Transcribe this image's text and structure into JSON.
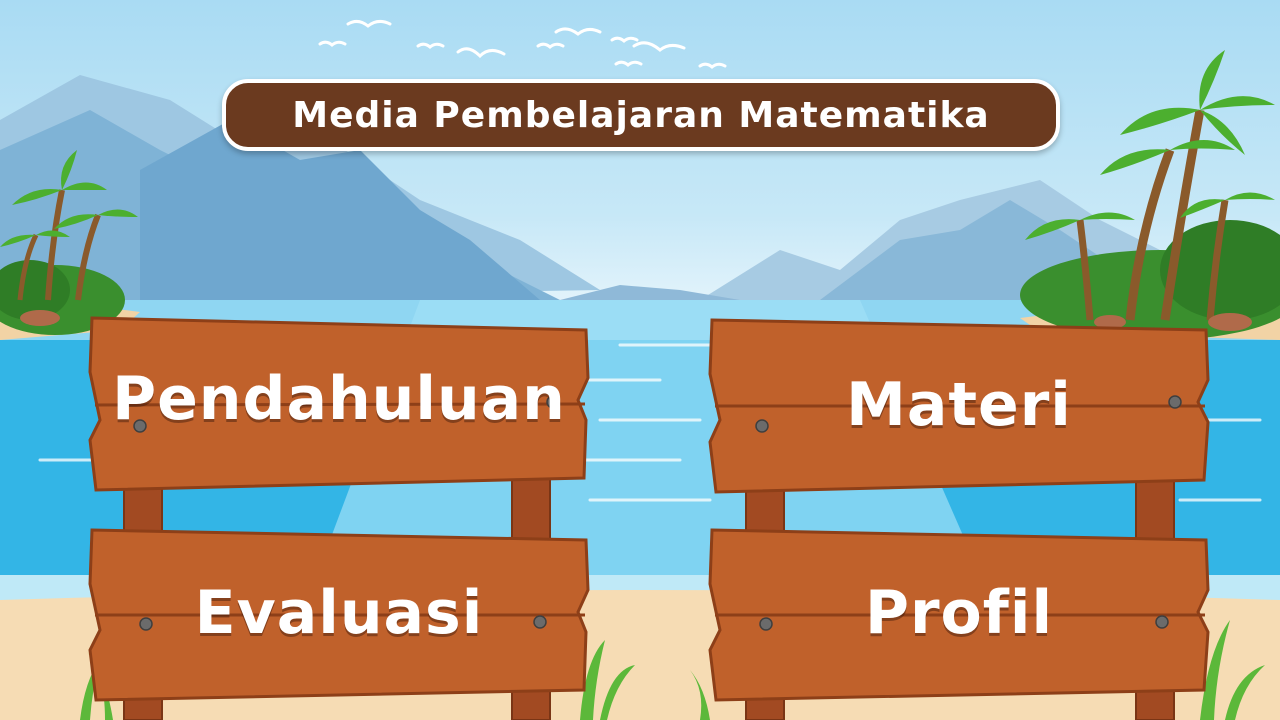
{
  "title": "Media Pembelajaran Matematika",
  "menu": {
    "pendahuluan": "Pendahuluan",
    "materi": "Materi",
    "evaluasi": "Evaluasi",
    "profil": "Profil"
  },
  "colors": {
    "title_bg": "#6b3a1f",
    "board": "#c0612b",
    "post": "#a24a22",
    "sea": "#32b6e8",
    "sand": "#f6dcb4"
  }
}
